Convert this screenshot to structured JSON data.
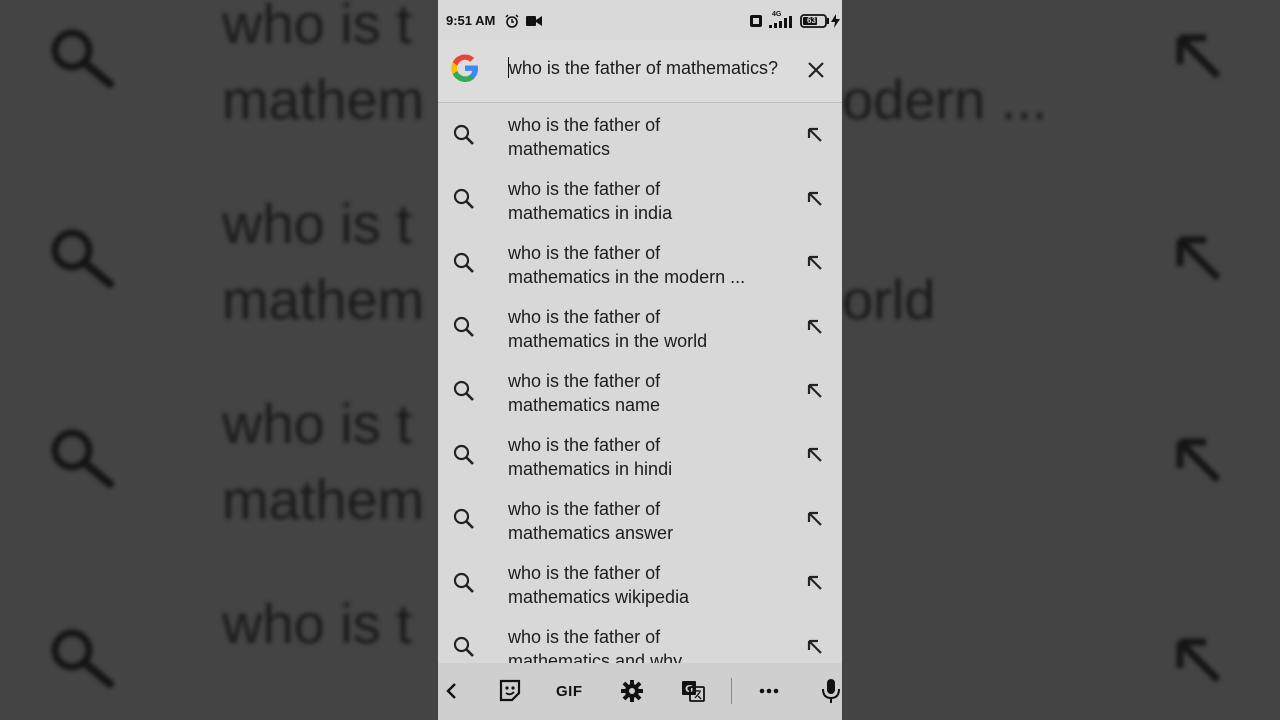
{
  "status_bar": {
    "time": "9:51 AM",
    "network": "4G",
    "battery": "63"
  },
  "search": {
    "query": "who is the father of mathematics?"
  },
  "suggestions": [
    {
      "line1": "who is the father of",
      "line2": "mathematics"
    },
    {
      "line1": "who is the father of",
      "line2": "mathematics in india"
    },
    {
      "line1": "who is the father of",
      "line2": "mathematics in the modern ..."
    },
    {
      "line1": "who is the father of",
      "line2": "mathematics in the world"
    },
    {
      "line1": "who is the father of",
      "line2": "mathematics name"
    },
    {
      "line1": "who is the father of",
      "line2": "mathematics in hindi"
    },
    {
      "line1": "who is the father of",
      "line2": "mathematics answer"
    },
    {
      "line1": "who is the father of",
      "line2": "mathematics wikipedia"
    },
    {
      "line1": "who is the father of",
      "line2": "mathematics and why"
    }
  ],
  "keyboard_toolbar": {
    "gif_label": "GIF"
  },
  "background": {
    "left_line1": "who is t",
    "left_line2_a": "mathem",
    "left_line2_b": "mathem",
    "left_line2_c": "mathem",
    "right_text_1": "odern ...",
    "right_text_2": "orld"
  },
  "colors": {
    "panel_bg": "#d8d8d8",
    "text": "#1c1c1c",
    "google_blue": "#4285F4",
    "google_red": "#EA4335",
    "google_yellow": "#FBBC05",
    "google_green": "#34A853"
  }
}
